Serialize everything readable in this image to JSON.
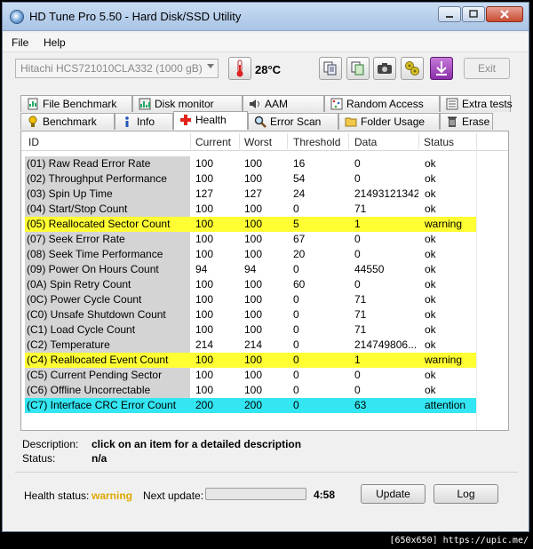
{
  "window": {
    "title": "HD Tune Pro 5.50 - Hard Disk/SSD Utility"
  },
  "menu": {
    "file": "File",
    "help": "Help"
  },
  "toolbar": {
    "drive": "Hitachi HCS721010CLA332 (1000 gB)",
    "temperature": "28°C",
    "exit_label": "Exit"
  },
  "tabs_top": [
    {
      "label": "File Benchmark",
      "icon": "file-benchmark-icon"
    },
    {
      "label": "Disk monitor",
      "icon": "disk-monitor-icon"
    },
    {
      "label": "AAM",
      "icon": "speaker-icon"
    },
    {
      "label": "Random Access",
      "icon": "random-access-icon"
    },
    {
      "label": "Extra tests",
      "icon": "extra-tests-icon"
    }
  ],
  "tabs_bottom": [
    {
      "label": "Benchmark",
      "icon": "benchmark-icon"
    },
    {
      "label": "Info",
      "icon": "info-icon"
    },
    {
      "label": "Health",
      "icon": "health-cross-icon",
      "active": true
    },
    {
      "label": "Error Scan",
      "icon": "magnifier-icon"
    },
    {
      "label": "Folder Usage",
      "icon": "folder-icon"
    },
    {
      "label": "Erase",
      "icon": "trash-icon"
    }
  ],
  "table": {
    "headers": [
      "ID",
      "Current",
      "Worst",
      "Threshold",
      "Data",
      "Status"
    ],
    "rows": [
      {
        "id": "(01) Raw Read Error Rate",
        "current": "100",
        "worst": "100",
        "threshold": "16",
        "data": "0",
        "status": "ok",
        "level": "ok"
      },
      {
        "id": "(02) Throughput Performance",
        "current": "100",
        "worst": "100",
        "threshold": "54",
        "data": "0",
        "status": "ok",
        "level": "ok"
      },
      {
        "id": "(03) Spin Up Time",
        "current": "127",
        "worst": "127",
        "threshold": "24",
        "data": "21493121342",
        "status": "ok",
        "level": "ok"
      },
      {
        "id": "(04) Start/Stop Count",
        "current": "100",
        "worst": "100",
        "threshold": "0",
        "data": "71",
        "status": "ok",
        "level": "ok"
      },
      {
        "id": "(05) Reallocated Sector Count",
        "current": "100",
        "worst": "100",
        "threshold": "5",
        "data": "1",
        "status": "warning",
        "level": "warn"
      },
      {
        "id": "(07) Seek Error Rate",
        "current": "100",
        "worst": "100",
        "threshold": "67",
        "data": "0",
        "status": "ok",
        "level": "ok"
      },
      {
        "id": "(08) Seek Time Performance",
        "current": "100",
        "worst": "100",
        "threshold": "20",
        "data": "0",
        "status": "ok",
        "level": "ok"
      },
      {
        "id": "(09) Power On Hours Count",
        "current": "94",
        "worst": "94",
        "threshold": "0",
        "data": "44550",
        "status": "ok",
        "level": "ok"
      },
      {
        "id": "(0A) Spin Retry Count",
        "current": "100",
        "worst": "100",
        "threshold": "60",
        "data": "0",
        "status": "ok",
        "level": "ok"
      },
      {
        "id": "(0C) Power Cycle Count",
        "current": "100",
        "worst": "100",
        "threshold": "0",
        "data": "71",
        "status": "ok",
        "level": "ok"
      },
      {
        "id": "(C0) Unsafe Shutdown Count",
        "current": "100",
        "worst": "100",
        "threshold": "0",
        "data": "71",
        "status": "ok",
        "level": "ok"
      },
      {
        "id": "(C1) Load Cycle Count",
        "current": "100",
        "worst": "100",
        "threshold": "0",
        "data": "71",
        "status": "ok",
        "level": "ok"
      },
      {
        "id": "(C2) Temperature",
        "current": "214",
        "worst": "214",
        "threshold": "0",
        "data": "214749806...",
        "status": "ok",
        "level": "ok"
      },
      {
        "id": "(C4) Reallocated Event Count",
        "current": "100",
        "worst": "100",
        "threshold": "0",
        "data": "1",
        "status": "warning",
        "level": "warn"
      },
      {
        "id": "(C5) Current Pending Sector",
        "current": "100",
        "worst": "100",
        "threshold": "0",
        "data": "0",
        "status": "ok",
        "level": "ok"
      },
      {
        "id": "(C6) Offline Uncorrectable",
        "current": "100",
        "worst": "100",
        "threshold": "0",
        "data": "0",
        "status": "ok",
        "level": "ok"
      },
      {
        "id": "(C7) Interface CRC Error Count",
        "current": "200",
        "worst": "200",
        "threshold": "0",
        "data": "63",
        "status": "attention",
        "level": "attn"
      }
    ]
  },
  "description": {
    "desc_label": "Description:",
    "desc_value": "click on an item for a detailed description",
    "status_label": "Status:",
    "status_value": "n/a"
  },
  "bottom": {
    "health_label": "Health status:",
    "health_value": "warning",
    "next_label": "Next update:",
    "progress_fraction": 0.0,
    "timer": "4:58",
    "update_label": "Update",
    "log_label": "Log"
  },
  "badge": "[650x650] https://upic.me/",
  "colors": {
    "warning_row": "#ffff33",
    "attention_row": "#33e6f2",
    "health_warning_text": "#e0a800"
  }
}
